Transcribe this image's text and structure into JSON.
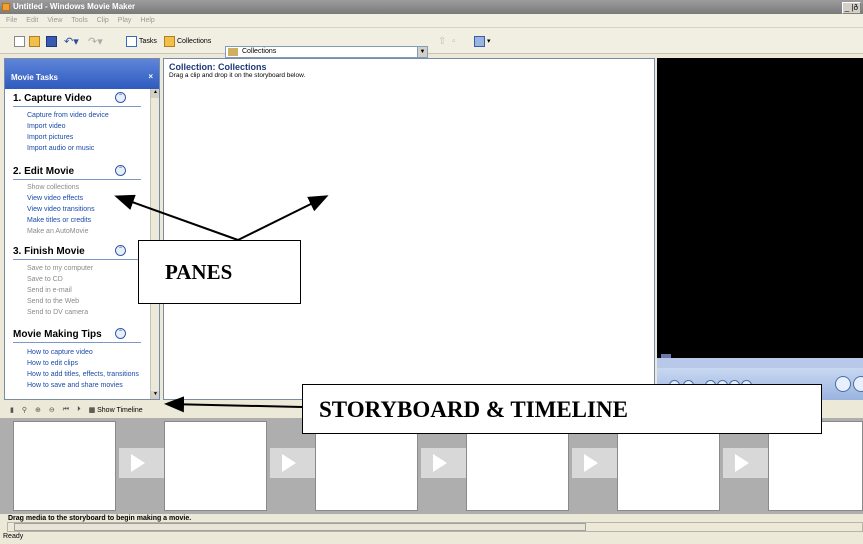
{
  "window": {
    "title": "Untitled - Windows Movie Maker",
    "controls": "_ |ð"
  },
  "menu": [
    "File",
    "Edit",
    "View",
    "Tools",
    "Clip",
    "Play",
    "Help"
  ],
  "toolbar": {
    "tasks_label": "Tasks",
    "collections_label": "Collections",
    "combo_value": "Collections"
  },
  "tasks": {
    "title": "Movie Tasks",
    "close": "×",
    "sections": [
      {
        "title": "1. Capture Video",
        "links": [
          {
            "label": "Capture from video device",
            "enabled": true
          },
          {
            "label": "Import video",
            "enabled": true
          },
          {
            "label": "Import pictures",
            "enabled": true
          },
          {
            "label": "Import audio or music",
            "enabled": true
          }
        ]
      },
      {
        "title": "2. Edit Movie",
        "links": [
          {
            "label": "Show collections",
            "enabled": false
          },
          {
            "label": "View video effects",
            "enabled": true
          },
          {
            "label": "View video transitions",
            "enabled": true
          },
          {
            "label": "Make titles or credits",
            "enabled": true
          },
          {
            "label": "Make an AutoMovie",
            "enabled": false
          }
        ]
      },
      {
        "title": "3. Finish Movie",
        "links": [
          {
            "label": "Save to my computer",
            "enabled": false
          },
          {
            "label": "Save to CD",
            "enabled": false
          },
          {
            "label": "Send in e-mail",
            "enabled": false
          },
          {
            "label": "Send to the Web",
            "enabled": false
          },
          {
            "label": "Send to DV camera",
            "enabled": false
          }
        ]
      },
      {
        "title": "Movie Making Tips",
        "links": [
          {
            "label": "How to capture video",
            "enabled": true
          },
          {
            "label": "How to edit clips",
            "enabled": true
          },
          {
            "label": "How to add titles, effects, transitions",
            "enabled": true
          },
          {
            "label": "How to save and share movies",
            "enabled": true
          }
        ]
      }
    ]
  },
  "collection": {
    "title": "Collection: Collections",
    "subtitle": "Drag a clip and drop it on the storyboard below."
  },
  "storyboard": {
    "show_timeline_label": "Show Timeline",
    "message": "Drag media to the storyboard to begin making a movie."
  },
  "status": "Ready",
  "callouts": {
    "panes": "PANES",
    "storyboard": "STORYBOARD & TIMELINE"
  }
}
